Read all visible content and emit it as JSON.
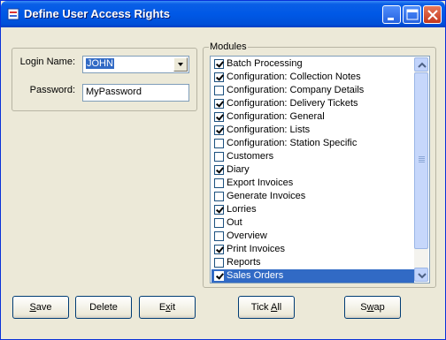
{
  "window": {
    "title": "Define User Access Rights"
  },
  "login_group": {
    "login_label": "Login Name:",
    "login_value": "JOHN",
    "password_label": "Password:",
    "password_value": "MyPassword"
  },
  "modules_group": {
    "label": "Modules",
    "items": [
      {
        "label": "Batch Processing",
        "checked": true
      },
      {
        "label": "Configuration: Collection Notes",
        "checked": true
      },
      {
        "label": "Configuration: Company Details",
        "checked": false
      },
      {
        "label": "Configuration: Delivery Tickets",
        "checked": true
      },
      {
        "label": "Configuration: General",
        "checked": true
      },
      {
        "label": "Configuration: Lists",
        "checked": true
      },
      {
        "label": "Configuration: Station Specific",
        "checked": false
      },
      {
        "label": "Customers",
        "checked": false
      },
      {
        "label": "Diary",
        "checked": true
      },
      {
        "label": "Export Invoices",
        "checked": false
      },
      {
        "label": "Generate Invoices",
        "checked": false
      },
      {
        "label": "Lorries",
        "checked": true
      },
      {
        "label": "Out",
        "checked": false
      },
      {
        "label": "Overview",
        "checked": false
      },
      {
        "label": "Print Invoices",
        "checked": true
      },
      {
        "label": "Reports",
        "checked": false
      },
      {
        "label": "Sales Orders",
        "checked": true,
        "selected": true
      }
    ]
  },
  "buttons": {
    "save_first": "S",
    "save_rest": "ave",
    "delete_label": "Delete",
    "exit_first": "E",
    "exit_mid": "x",
    "exit_rest": "it",
    "tickall_first": "Tick ",
    "tickall_mid": "A",
    "tickall_rest": "ll",
    "swap_first": "S",
    "swap_mid": "w",
    "swap_rest": "ap"
  },
  "colors": {
    "titlebar": "#0058e6",
    "selection": "#316ac5",
    "window_bg": "#ece9d8"
  }
}
